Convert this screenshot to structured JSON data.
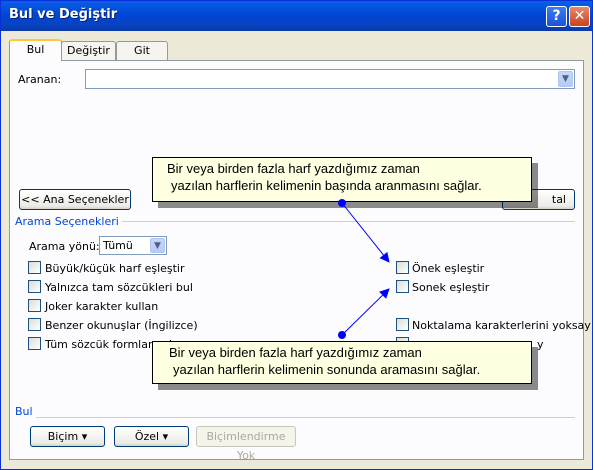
{
  "window": {
    "title": "Bul ve Değiştir"
  },
  "tabs": [
    "Bul",
    "Değiştir",
    "Git"
  ],
  "search": {
    "label": "Aranan:",
    "value": ""
  },
  "buttons": {
    "less_options": "<< Ana Seçenekler",
    "cancel_partial": "tal",
    "format": "Biçim",
    "special": "Özel",
    "no_formatting": "Biçimlendirme Yok"
  },
  "options_group": {
    "title": "Arama Seçenekleri",
    "direction_label": "Arama yönü:",
    "direction_value": "Tümü",
    "left_checks": [
      "Büyük/küçük harf eşleştir",
      "Yalnızca tam sözcükleri bul",
      "Joker karakter kullan",
      "Benzer okunuşlar (İngilizce)",
      "Tüm sözcük formlarını b"
    ],
    "right_checks": [
      "Önek eşleştir",
      "Sonek eşleştir",
      "Noktalama karakterlerini yoksay",
      "y"
    ]
  },
  "find_group": {
    "title": "Bul"
  },
  "callouts": {
    "top": [
      "Bir veya birden fazla harf yazdığımız zaman",
      "yazılan harflerin kelimenin başında aranmasını sağlar."
    ],
    "bottom": [
      "Bir veya birden fazla harf yazdığımız zaman",
      "yazılan harflerin kelimenin sonunda aramasını sağlar."
    ]
  },
  "colors": {
    "titlebar": "#0046d5",
    "group_title": "#0046d5",
    "callout_bg": "#ffffe1",
    "arrow": "#0000ff"
  }
}
